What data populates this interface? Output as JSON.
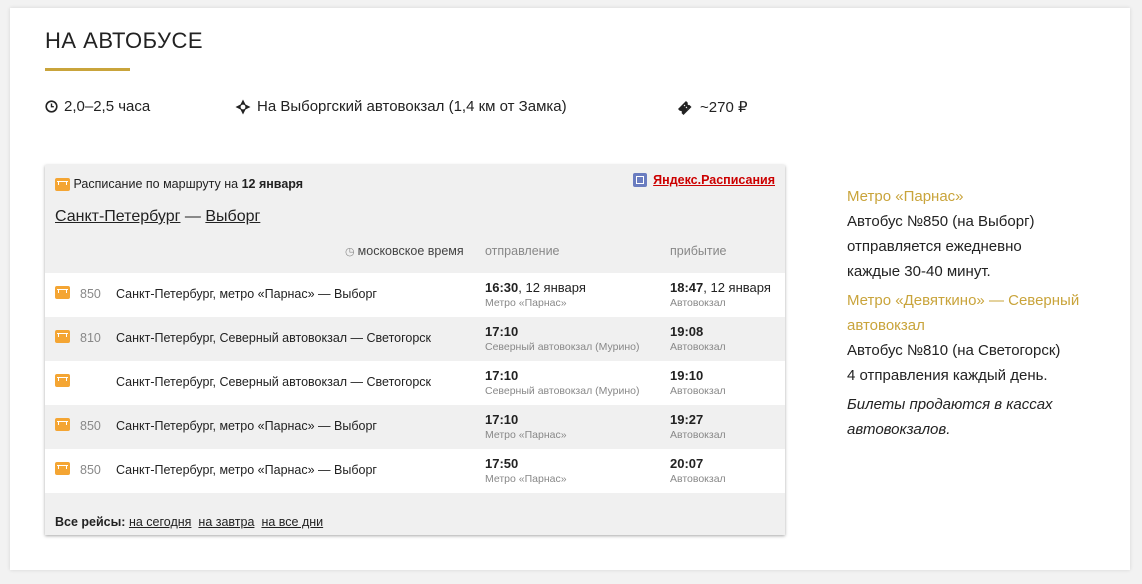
{
  "title": "НА АВТОБУСЕ",
  "facts": {
    "duration": "2,0–2,5 часа",
    "station": "На Выборгский автовокзал (1,4 км от Замка)",
    "price": "~270 ₽"
  },
  "widget": {
    "caption_prefix": "Расписание по маршруту на ",
    "caption_date": "12 января",
    "provider": "Яндекс.Расписания",
    "route_from": "Санкт-Петербург",
    "route_sep": " — ",
    "route_to": "Выборг",
    "tz": "московское время",
    "col_dep": "отправление",
    "col_arr": "прибытие",
    "rows": [
      {
        "num": "850",
        "name": "Санкт-Петербург, метро «Парнас» — Выборг",
        "dep_time": "16:30",
        "dep_date": ", 12 января",
        "dep_place": "Метро «Парнас»",
        "arr_time": "18:47",
        "arr_date": ", 12 января",
        "arr_place": "Автовокзал"
      },
      {
        "num": "810",
        "name": "Санкт-Петербург, Северный автовокзал — Светогорск",
        "dep_time": "17:10",
        "dep_date": "",
        "dep_place": "Северный автовокзал (Мурино)",
        "arr_time": "19:08",
        "arr_date": "",
        "arr_place": "Автовокзал"
      },
      {
        "num": "",
        "name": "Санкт-Петербург, Северный автовокзал — Светогорск",
        "dep_time": "17:10",
        "dep_date": "",
        "dep_place": "Северный автовокзал (Мурино)",
        "arr_time": "19:10",
        "arr_date": "",
        "arr_place": "Автовокзал"
      },
      {
        "num": "850",
        "name": "Санкт-Петербург, метро «Парнас» — Выборг",
        "dep_time": "17:10",
        "dep_date": "",
        "dep_place": "Метро «Парнас»",
        "arr_time": "19:27",
        "arr_date": "",
        "arr_place": "Автовокзал"
      },
      {
        "num": "850",
        "name": "Санкт-Петербург, метро «Парнас» — Выборг",
        "dep_time": "17:50",
        "dep_date": "",
        "dep_place": "Метро «Парнас»",
        "arr_time": "20:07",
        "arr_date": "",
        "arr_place": "Автовокзал"
      }
    ],
    "footer_label": "Все рейсы:",
    "footer_links": [
      "на сегодня",
      "на завтра",
      "на все дни"
    ]
  },
  "side": {
    "b1_title": "Метро «Парнас»",
    "b1_text1": "Автобус №850 (на Выборг)",
    "b1_text2": "отправляется ежедневно",
    "b1_text3": "каждые 30-40 минут.",
    "b2_title1": "Метро «Девяткино» — Северный",
    "b2_title2": "автовокзал",
    "b2_text1": "Автобус №810 (на Светогорск)",
    "b2_text2": "4 отправления каждый день.",
    "note1": "Билеты продаются в кассах",
    "note2": "автовокзалов."
  },
  "colors": {
    "accent": "#c9a43b",
    "bus": "#f4a533",
    "yandex": "#cc0000"
  }
}
